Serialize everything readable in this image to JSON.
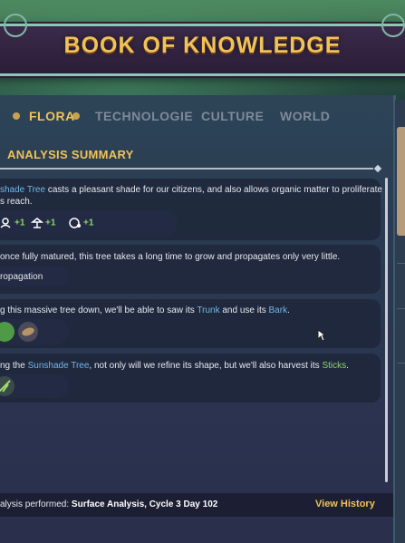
{
  "header": {
    "title": "BOOK OF KNOWLEDGE"
  },
  "tabs": [
    {
      "label": "FLORA",
      "active": true
    },
    {
      "label": "TECHNOLOGIE",
      "active": false
    },
    {
      "label": "CULTURE",
      "active": false
    },
    {
      "label": "WORLD",
      "active": false
    }
  ],
  "section": {
    "title": "ANALYSIS SUMMARY"
  },
  "cards": {
    "c1": {
      "line1_a": "shade Tree",
      "line1_b": " casts a pleasant shade for our citizens, and also allows organic matter to proliferate",
      "line2": "s reach.",
      "stats": [
        "+1",
        "+1",
        "+1"
      ]
    },
    "c2": {
      "line1": " once fully matured, this tree takes a long time to grow and propagates only very little.",
      "pill": "ropagation"
    },
    "c3": {
      "line1_a": "g this massive tree down, we'll be able to saw its ",
      "trunk": "Trunk",
      "line1_b": " and use its ",
      "bark": "Bark",
      "line1_c": "."
    },
    "c4": {
      "line1_a": "ng the ",
      "tree": "Sunshade Tree",
      "line1_b": ", not only will we refine its shape, but we'll also harvest its ",
      "sticks": "Sticks",
      "line1_c": "."
    }
  },
  "footer": {
    "label": "alysis performed:",
    "value": "Surface Analysis, Cycle 3 Day 102",
    "action": "View History"
  },
  "colors": {
    "accent": "#f1c257",
    "highlight_blue": "#6fb6e8",
    "highlight_green": "#8fd46b"
  }
}
